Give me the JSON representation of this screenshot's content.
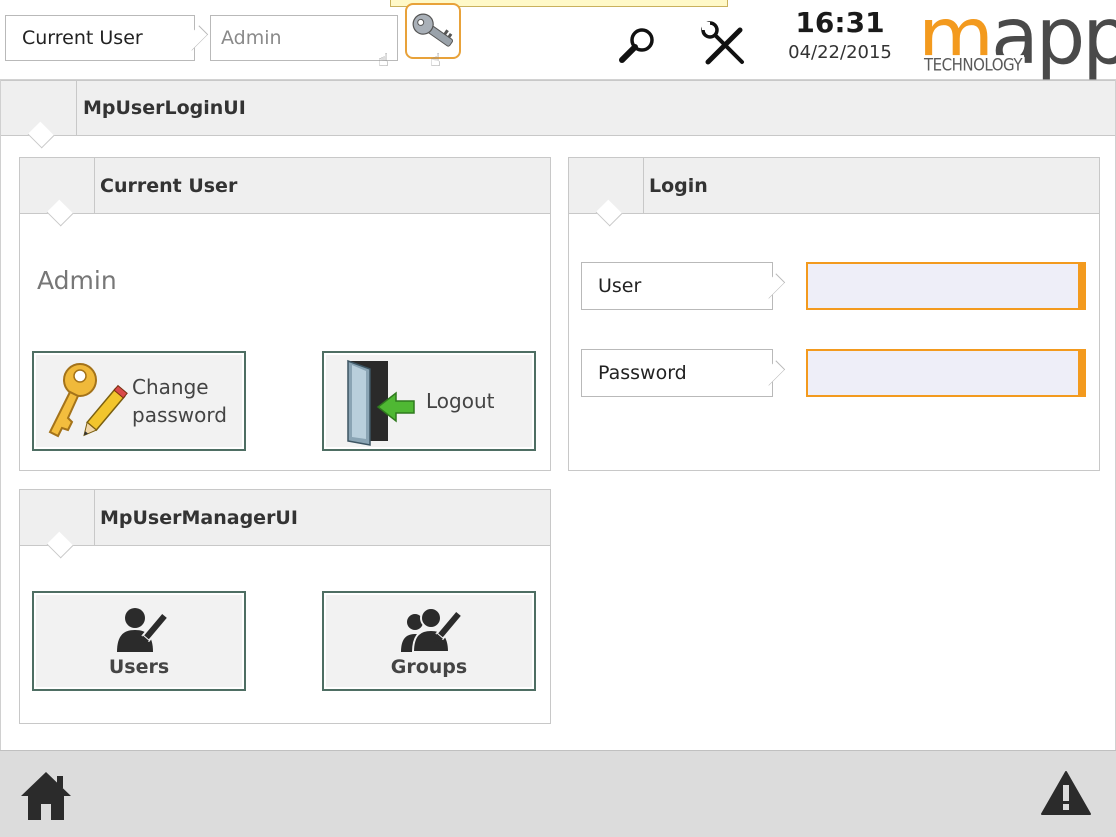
{
  "topbar": {
    "current_user_label": "Current User",
    "current_user_value": "Admin",
    "time": "16:31",
    "date": "04/22/2015",
    "logo_main": "mapp",
    "logo_m": "m",
    "logo_rest": "app",
    "logo_sub": "TECHNOLOGY",
    "key_icon": "key-icon",
    "search_icon": "search-icon",
    "tools_icon": "tools-icon"
  },
  "main": {
    "title": "MpUserLoginUI",
    "current_user_group": {
      "title": "Current User",
      "user_name": "Admin",
      "change_password_line1": "Change",
      "change_password_line2": "password",
      "logout_label": "Logout"
    },
    "login_group": {
      "title": "Login",
      "user_label": "User",
      "user_value": "",
      "password_label": "Password",
      "password_value": ""
    },
    "manager_group": {
      "title": "MpUserManagerUI",
      "users_label": "Users",
      "groups_label": "Groups"
    }
  },
  "footer": {
    "home_icon": "home-icon",
    "alarm_icon": "alarm-warning-icon"
  },
  "colors": {
    "accent_orange": "#f39a1e",
    "button_border": "#4e6e63",
    "header_bg": "#efefef",
    "footer_bg": "#dcdcdc",
    "input_bg": "#eeeef8"
  }
}
